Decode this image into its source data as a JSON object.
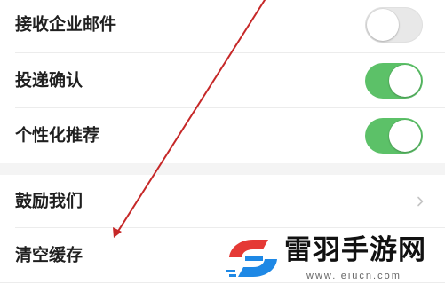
{
  "settings": {
    "rows": [
      {
        "label": "接收企业邮件",
        "control": "toggle",
        "enabled": false
      },
      {
        "label": "投递确认",
        "control": "toggle",
        "enabled": true
      },
      {
        "label": "个性化推荐",
        "control": "toggle",
        "enabled": true
      },
      {
        "label": "鼓励我们",
        "control": "chevron"
      },
      {
        "label": "清空缓存",
        "control": "none"
      }
    ]
  },
  "colors": {
    "toggle_on": "#5cc168",
    "toggle_off": "#e8e8e8",
    "annotation_arrow": "#c62828",
    "section_gap": "#f4f4f4"
  },
  "icons": {
    "chevron": "chevron-right-icon",
    "watermark_logo": "leiyu-logo-icon"
  },
  "watermark": {
    "brand": "雷羽手游网",
    "url": "www.leiucn.com"
  }
}
